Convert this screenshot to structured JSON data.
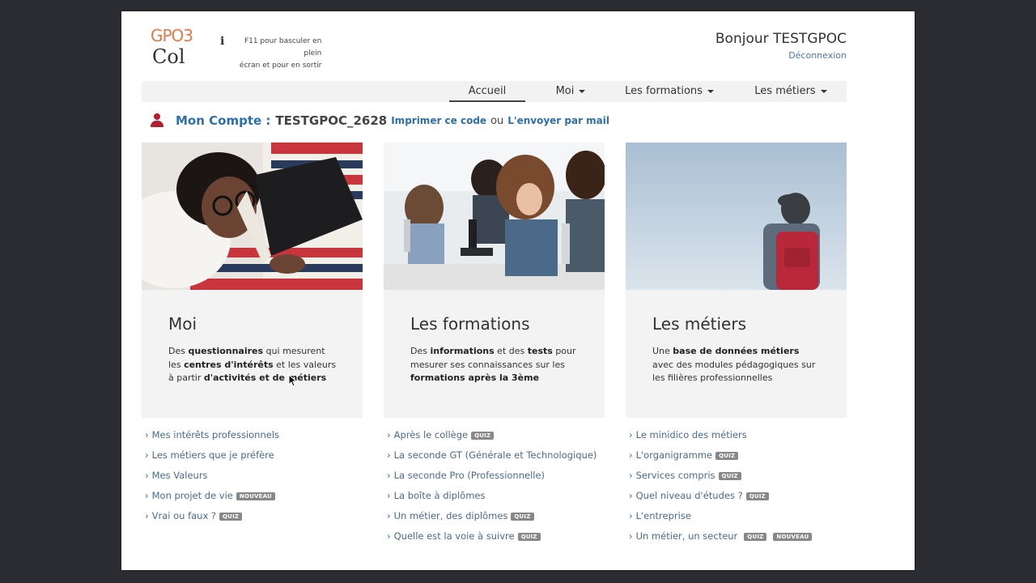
{
  "header": {
    "logo_gpo": "GPO3",
    "logo_col": "Col",
    "info_line1": "F11 pour basculer en plein",
    "info_line2": "écran et pour en sortir",
    "greeting": "Bonjour TESTGPOC",
    "logout": "Déconnexion"
  },
  "nav": {
    "items": [
      {
        "label": "Accueil",
        "active": true
      },
      {
        "label": "Moi",
        "dropdown": true
      },
      {
        "label": "Les formations",
        "dropdown": true
      },
      {
        "label": "Les métiers",
        "dropdown": true
      }
    ]
  },
  "account": {
    "label": "Mon Compte :",
    "code": "TESTGPOC_2628",
    "print_link": "Imprimer ce code",
    "or_text": "ou",
    "mail_link": "L'envoyer par mail"
  },
  "cards": [
    {
      "title": "Moi",
      "desc": [
        {
          "t": "Des ",
          "b": false
        },
        {
          "t": "questionnaires",
          "b": true
        },
        {
          "t": " qui mesurent les ",
          "b": false
        },
        {
          "t": "centres d'intérêts",
          "b": true
        },
        {
          "t": " et les valeurs à partir ",
          "b": false
        },
        {
          "t": "d'activités et de métiers",
          "b": true
        }
      ],
      "links": [
        {
          "label": "Mes intérêts professionnels",
          "badges": []
        },
        {
          "label": "Les métiers que je préfère",
          "badges": []
        },
        {
          "label": "Mes Valeurs",
          "badges": []
        },
        {
          "label": "Mon projet de vie",
          "badges": [
            "NOUVEAU"
          ]
        },
        {
          "label": "Vrai ou faux ?",
          "badges": [
            "QUIZ"
          ]
        }
      ]
    },
    {
      "title": "Les formations",
      "desc": [
        {
          "t": "Des ",
          "b": false
        },
        {
          "t": "informations",
          "b": true
        },
        {
          "t": " et des ",
          "b": false
        },
        {
          "t": "tests",
          "b": true
        },
        {
          "t": " pour mesurer ses connaissances sur les ",
          "b": false
        },
        {
          "t": "formations après la 3ème",
          "b": true
        }
      ],
      "links": [
        {
          "label": "Après le collège",
          "badges": [
            "QUIZ"
          ]
        },
        {
          "label": "La seconde GT (Générale et Technologique)",
          "badges": []
        },
        {
          "label": "La seconde Pro (Professionnelle)",
          "badges": []
        },
        {
          "label": "La boîte à diplômes",
          "badges": []
        },
        {
          "label": "Un métier, des diplômes",
          "badges": [
            "QUIZ"
          ]
        },
        {
          "label": "Quelle est la voie à suivre",
          "badges": [
            "QUIZ"
          ]
        }
      ]
    },
    {
      "title": "Les métiers",
      "desc": [
        {
          "t": "Une ",
          "b": false
        },
        {
          "t": "base de données métiers",
          "b": true
        },
        {
          "t": " avec des modules pédagogiques sur les filières professionnelles",
          "b": false
        }
      ],
      "links": [
        {
          "label": "Le minidico des métiers",
          "badges": []
        },
        {
          "label": "L'organigramme",
          "badges": [
            "QUIZ"
          ]
        },
        {
          "label": "Services compris",
          "badges": [
            "QUIZ"
          ]
        },
        {
          "label": "Quel niveau d'études ?",
          "badges": [
            "QUIZ"
          ]
        },
        {
          "label": "L'entreprise",
          "badges": []
        },
        {
          "label": "Un métier, un secteur",
          "badges": [
            "QUIZ",
            "NOUVEAU"
          ]
        }
      ]
    }
  ],
  "colors": {
    "accent_blue": "#2e6fa6",
    "link_blue": "#4a6b8f",
    "user_icon_red": "#b01e2f",
    "logo_orange": "#e07a4a",
    "badge_gray": "#888888"
  }
}
